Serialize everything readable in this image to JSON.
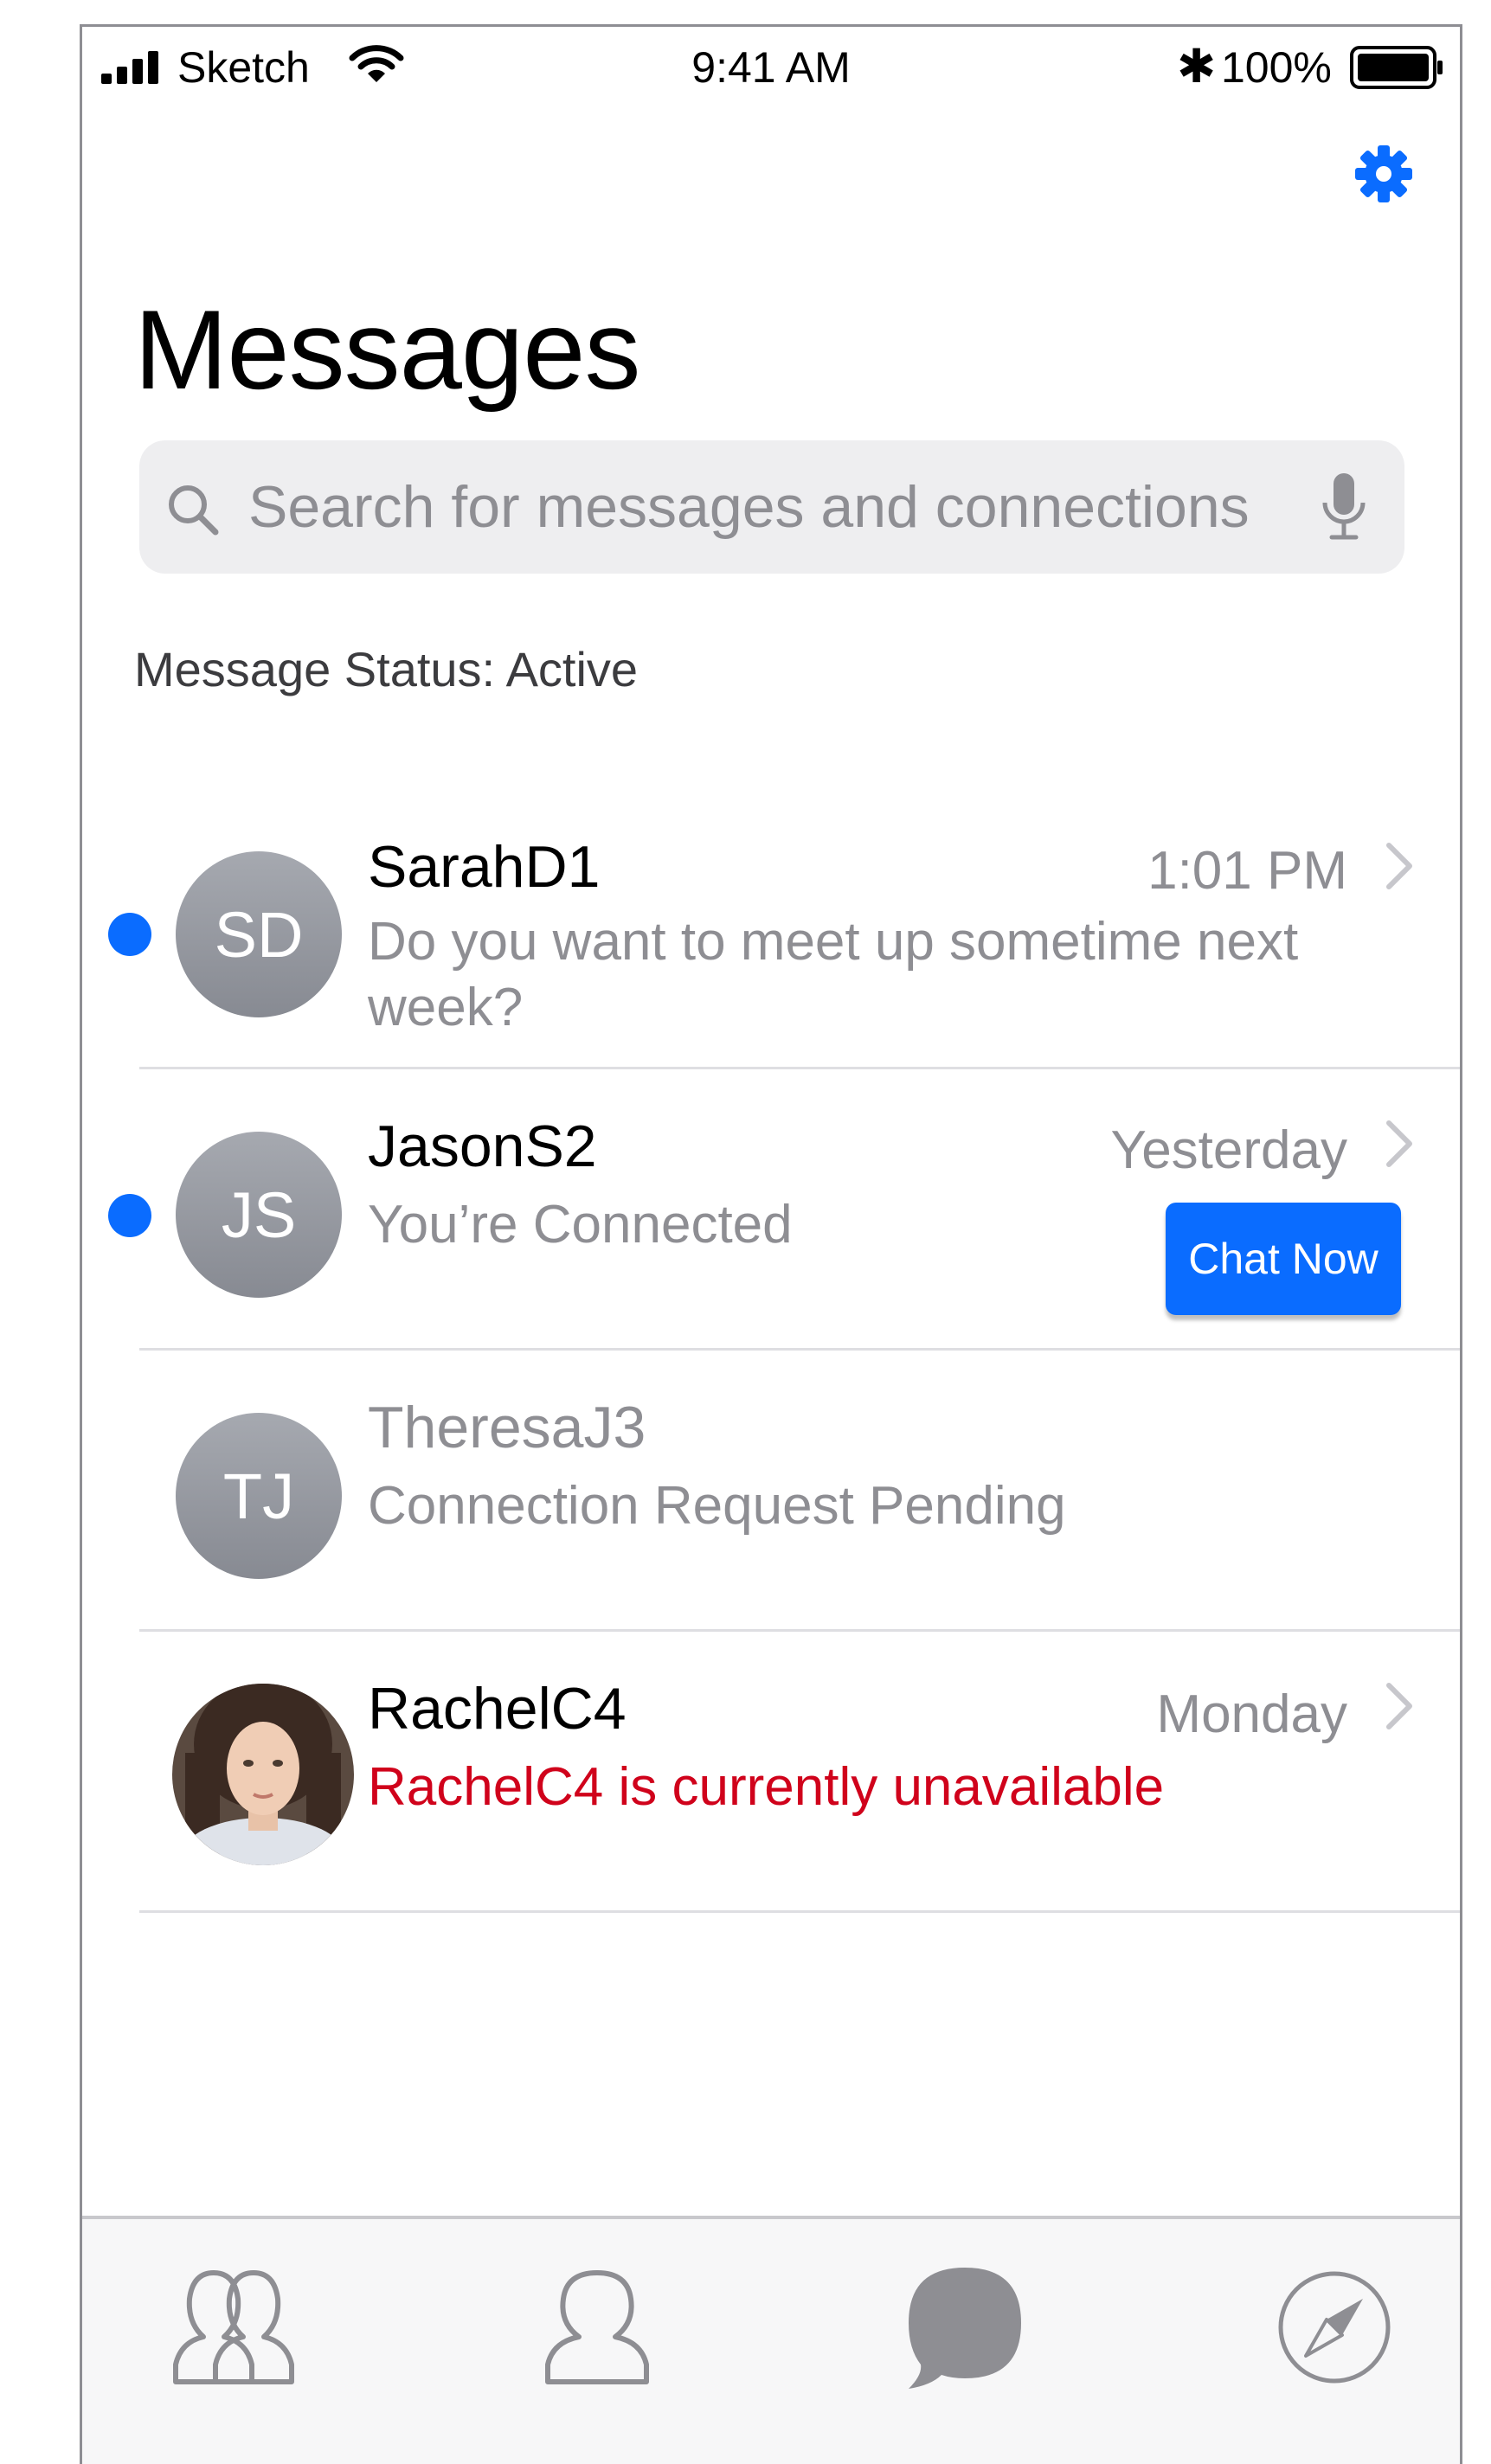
{
  "status_bar": {
    "carrier": "Sketch",
    "time": "9:41 AM",
    "battery_percent": "100%",
    "icons": [
      "signal-icon",
      "wifi-icon",
      "bluetooth-icon",
      "battery-icon"
    ]
  },
  "header": {
    "title": "Messages",
    "settings_icon": "gear-icon",
    "accent_color": "#0a6cff"
  },
  "search": {
    "placeholder": "Search for messages and connections",
    "value": "",
    "icons": [
      "search-icon",
      "microphone-icon"
    ]
  },
  "message_status": "Message Status: Active",
  "conversations": [
    {
      "initials": "SD",
      "name": "SarahD1",
      "time": "1:01 PM",
      "preview": "Do you want to meet up sometime next week?",
      "unread": true
    },
    {
      "initials": "JS",
      "name": "JasonS2",
      "time": "Yesterday",
      "preview": "You’re Connected",
      "unread": true,
      "action_label": "Chat Now"
    },
    {
      "initials": "TJ",
      "name": "TheresaJ3",
      "time": "",
      "preview": "Connection Request Pending",
      "unread": false
    },
    {
      "initials": "",
      "name": "RachelC4",
      "time": "Monday",
      "preview": "RachelC4 is currently unavailable",
      "unread": false,
      "preview_color": "#d0021b"
    }
  ],
  "tab_bar": {
    "tabs": [
      "people-icon",
      "profile-icon",
      "messages-icon",
      "compass-icon"
    ],
    "active_tab": "messages-icon"
  }
}
